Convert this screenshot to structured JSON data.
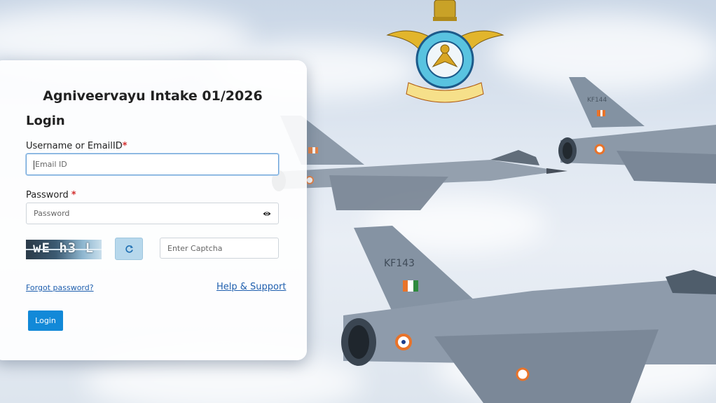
{
  "page": {
    "title": "Agniveervayu Intake 01/2026",
    "heading": "Login"
  },
  "form": {
    "username_label": "Username or EmailID",
    "username_required": "*",
    "username_placeholder": "Email ID",
    "password_label": "Password",
    "password_required": "*",
    "password_placeholder": "Password",
    "captcha_text": "wE h3 L",
    "captcha_placeholder": "Enter Captcha",
    "forgot_password": "Forgot password?",
    "help_support": "Help & Support",
    "login_button": "Login"
  },
  "icons": {
    "password_toggle": "eye-icon",
    "captcha_refresh": "refresh-icon"
  },
  "colors": {
    "primary_button": "#1289d8",
    "link": "#1f5fae",
    "required": "#d32f2f",
    "refresh_button": "#b7d8ec"
  },
  "aircraft_markings": [
    "KF143",
    "KF144"
  ]
}
